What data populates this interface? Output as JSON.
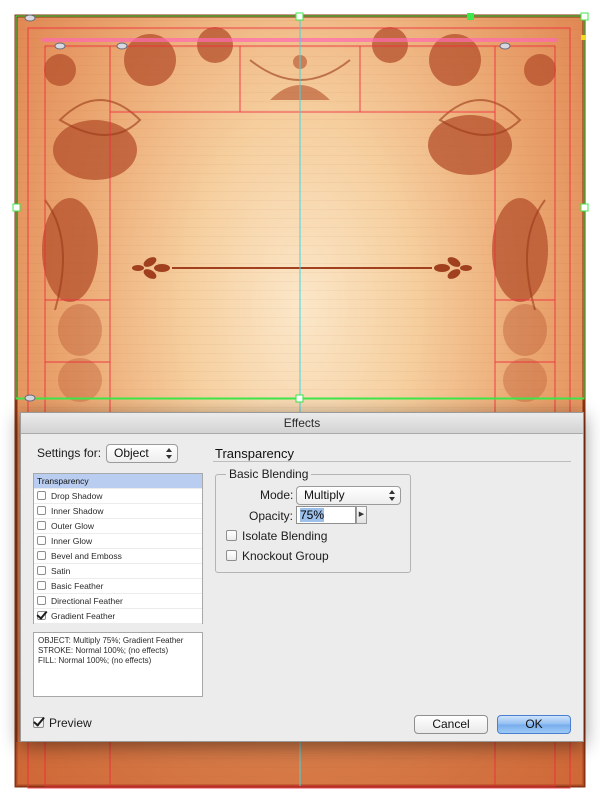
{
  "dialog": {
    "title": "Effects",
    "settings_for_label": "Settings for:",
    "settings_for_value": "Object",
    "section_title": "Transparency",
    "effects": [
      {
        "label": "Transparency",
        "has_checkbox": false,
        "checked": false,
        "selected": true
      },
      {
        "label": "Drop Shadow",
        "has_checkbox": true,
        "checked": false,
        "selected": false
      },
      {
        "label": "Inner Shadow",
        "has_checkbox": true,
        "checked": false,
        "selected": false
      },
      {
        "label": "Outer Glow",
        "has_checkbox": true,
        "checked": false,
        "selected": false
      },
      {
        "label": "Inner Glow",
        "has_checkbox": true,
        "checked": false,
        "selected": false
      },
      {
        "label": "Bevel and Emboss",
        "has_checkbox": true,
        "checked": false,
        "selected": false
      },
      {
        "label": "Satin",
        "has_checkbox": true,
        "checked": false,
        "selected": false
      },
      {
        "label": "Basic Feather",
        "has_checkbox": true,
        "checked": false,
        "selected": false
      },
      {
        "label": "Directional Feather",
        "has_checkbox": true,
        "checked": false,
        "selected": false
      },
      {
        "label": "Gradient Feather",
        "has_checkbox": true,
        "checked": true,
        "selected": false
      }
    ],
    "summary": [
      "OBJECT: Multiply 75%; Gradient Feather",
      "STROKE: Normal 100%; (no effects)",
      "FILL: Normal 100%; (no effects)"
    ],
    "basic_blending": {
      "legend": "Basic Blending",
      "mode_label": "Mode:",
      "mode_value": "Multiply",
      "opacity_label": "Opacity:",
      "opacity_value": "75%",
      "isolate_label": "Isolate Blending",
      "isolate_checked": false,
      "knockout_label": "Knockout Group",
      "knockout_checked": false
    },
    "preview_label": "Preview",
    "preview_checked": true,
    "cancel_label": "Cancel",
    "ok_label": "OK"
  },
  "colors": {
    "artwork_dark": "#a0401e",
    "guide_red": "#f02a3c",
    "guide_cyan": "#3fd6e6",
    "guide_green": "#3fe84a",
    "selection_blue": "#b8cdf0"
  }
}
